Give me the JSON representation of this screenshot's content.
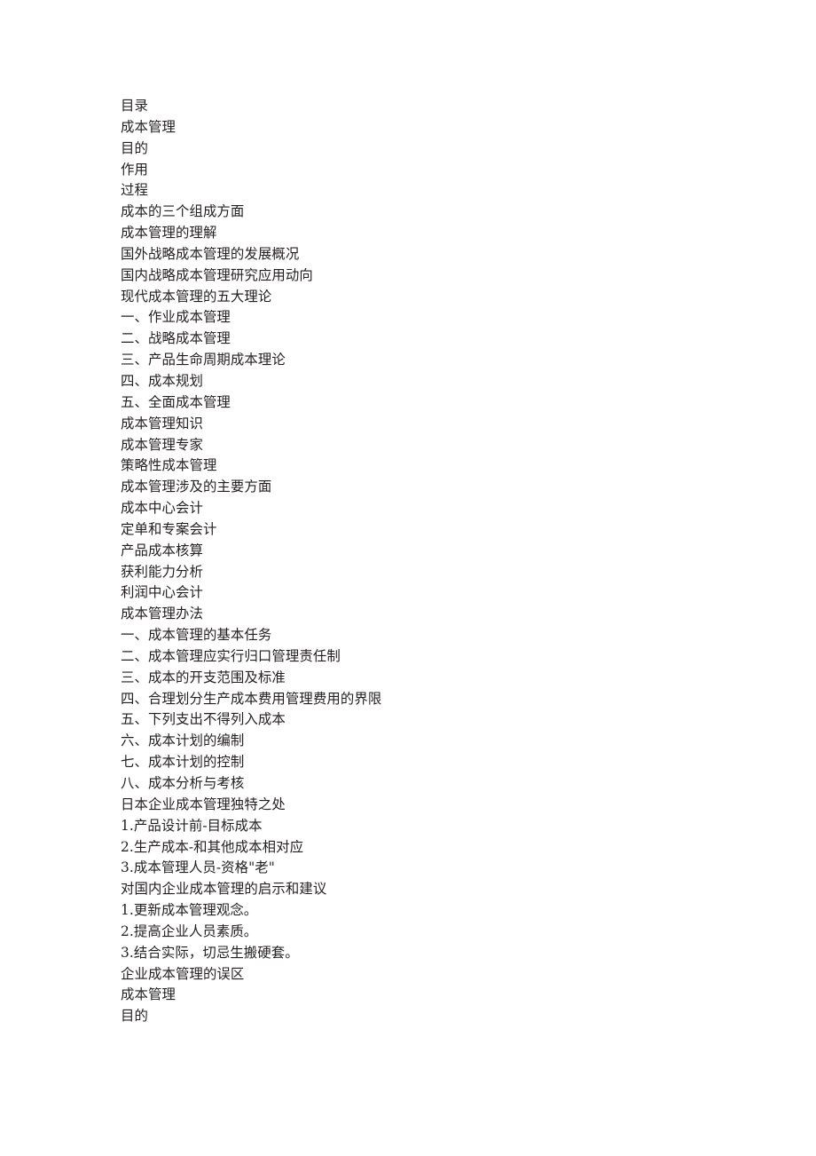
{
  "document": {
    "kind": "table-of-contents",
    "heading": "目录",
    "background_color": "#ffffff",
    "text_color": "#231f20",
    "lines": [
      "目录",
      "成本管理",
      "目的",
      "作用",
      "过程",
      "成本的三个组成方面",
      "成本管理的理解",
      "国外战略成本管理的发展概况",
      "国内战略成本管理研究应用动向",
      "现代成本管理的五大理论",
      "一、作业成本管理",
      "二、战略成本管理",
      "三、产品生命周期成本理论",
      "四、成本规划",
      "五、全面成本管理",
      "成本管理知识",
      "成本管理专家",
      "策略性成本管理",
      "成本管理涉及的主要方面",
      "成本中心会计",
      "定单和专案会计",
      "产品成本核算",
      "获利能力分析",
      "利润中心会计",
      "成本管理办法",
      "一、成本管理的基本任务",
      "二、成本管理应实行归口管理责任制",
      "三、成本的开支范围及标准",
      "四、合理划分生产成本费用管理费用的界限",
      "五、下列支出不得列入成本",
      "六、成本计划的编制",
      "七、成本计划的控制",
      "八、成本分析与考核",
      "日本企业成本管理独特之处",
      "1.产品设计前-目标成本",
      "2.生产成本-和其他成本相对应",
      "3.成本管理人员-资格\"老\"",
      "对国内企业成本管理的启示和建议",
      "1.更新成本管理观念。",
      "2.提高企业人员素质。",
      "3.结合实际，切忌生搬硬套。",
      "企业成本管理的误区",
      "成本管理",
      "目的"
    ]
  }
}
